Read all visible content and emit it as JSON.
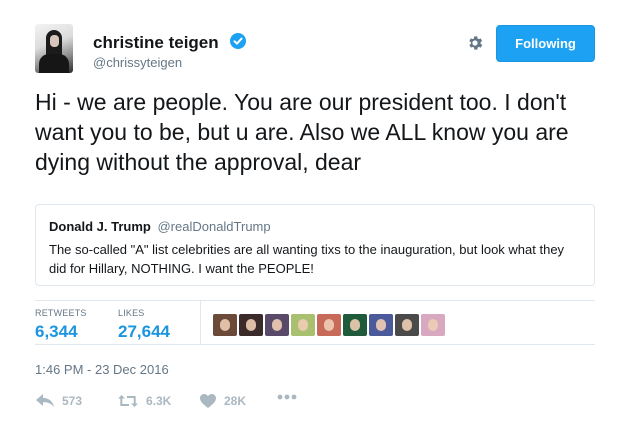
{
  "author": {
    "name": "christine teigen",
    "handle": "@chrissyteigen"
  },
  "follow_button": {
    "label": "Following"
  },
  "tweet": {
    "text": "Hi - we are people. You are our president too. I don't want you to be, but u are. Also we ALL know you are dying without the approval, dear"
  },
  "quoted_tweet": {
    "name": "Donald J. Trump",
    "handle": "@realDonaldTrump",
    "text": "The so-called \"A\" list celebrities are all wanting tixs to the inauguration, but look what they did for Hillary, NOTHING. I want the PEOPLE!"
  },
  "stats": {
    "retweets_label": "RETWEETS",
    "retweets_value": "6,344",
    "likes_label": "LIKES",
    "likes_value": "27,644"
  },
  "liker_avatars": [
    {
      "bg": "#6b4a3a"
    },
    {
      "bg": "#3b2a2a"
    },
    {
      "bg": "#5a4a6a"
    },
    {
      "bg": "#a8c070"
    },
    {
      "bg": "#c76a5a"
    },
    {
      "bg": "#1f5a3a"
    },
    {
      "bg": "#4a5a9a"
    },
    {
      "bg": "#4a4a4a"
    },
    {
      "bg": "#d8a8c0"
    }
  ],
  "timestamp": "1:46 PM - 23 Dec 2016",
  "actions": {
    "reply_count": "573",
    "retweet_count": "6.3K",
    "like_count": "28K"
  },
  "colors": {
    "accent": "#1da1f2",
    "link": "#1b95e0",
    "muted": "#657786",
    "border": "#e1e8ed"
  }
}
